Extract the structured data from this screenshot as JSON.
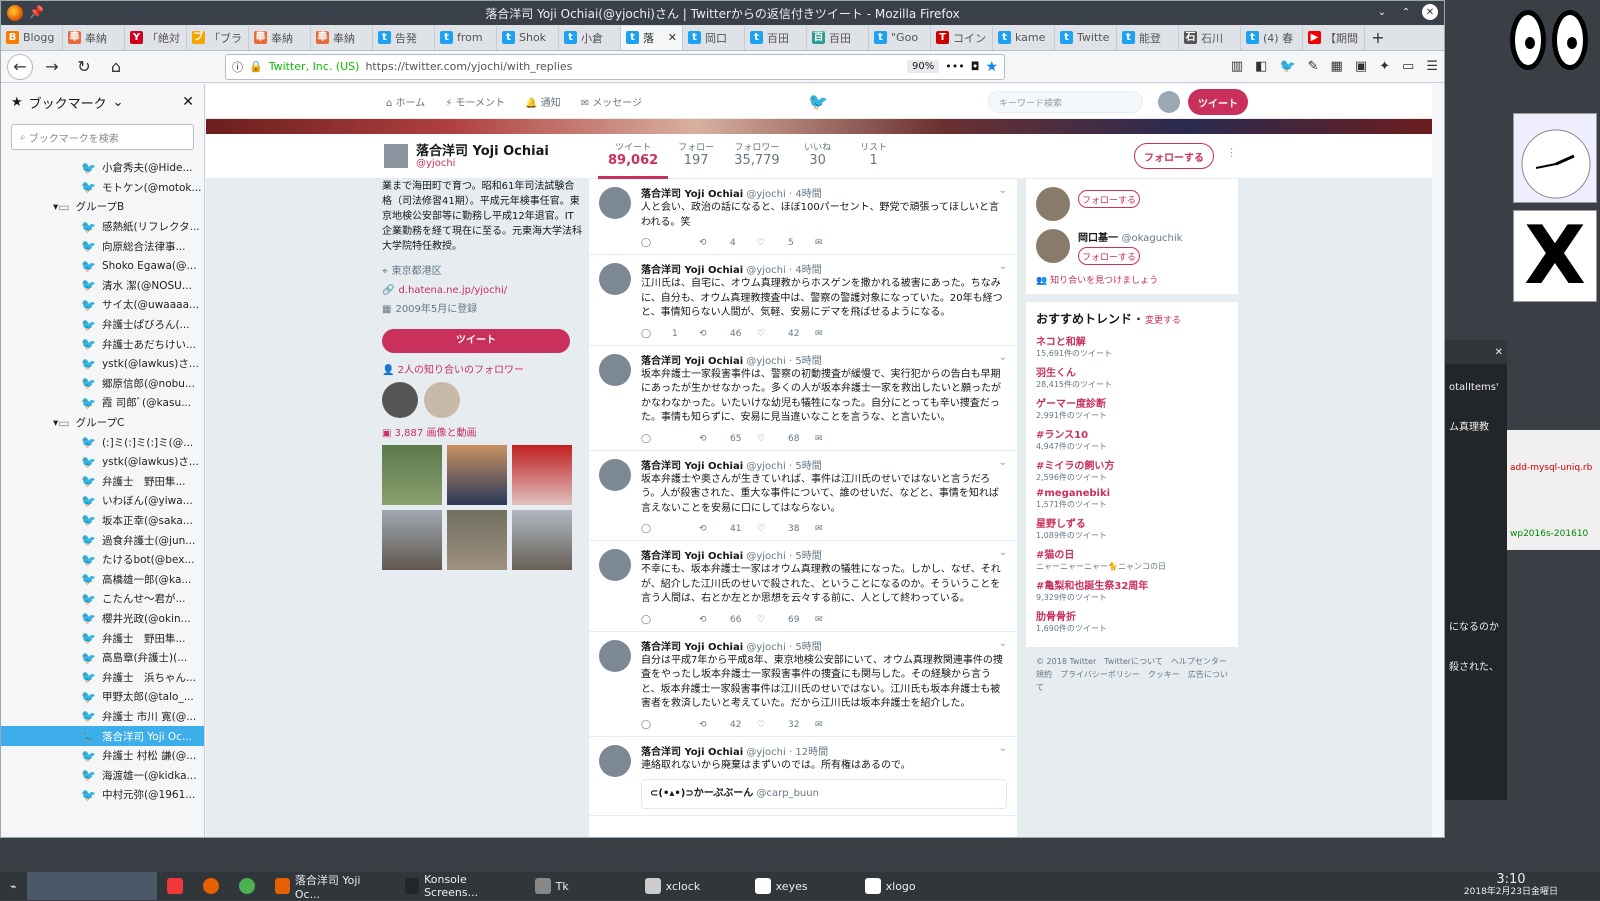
{
  "window": {
    "title": "落合洋司 Yoji Ochiai(@yjochi)さん | Twitterからの返信付きツイート - Mozilla Firefox"
  },
  "tabs": [
    {
      "label": "Blogg",
      "color": "#f57d00",
      "glyph": "B"
    },
    {
      "label": "奉納",
      "color": "#e8693a",
      "glyph": "奉"
    },
    {
      "label": "「絶対",
      "color": "#d0021b",
      "glyph": "Y"
    },
    {
      "label": "「ブラ",
      "color": "#f7a600",
      "glyph": "ブ"
    },
    {
      "label": "奉納",
      "color": "#e8693a",
      "glyph": "奉"
    },
    {
      "label": "奉納",
      "color": "#e8693a",
      "glyph": "奉"
    },
    {
      "label": "告発",
      "color": "#1da1f2",
      "glyph": "t"
    },
    {
      "label": "from",
      "color": "#1da1f2",
      "glyph": "t"
    },
    {
      "label": "Shok",
      "color": "#1da1f2",
      "glyph": "t"
    },
    {
      "label": "小倉",
      "color": "#1da1f2",
      "glyph": "t"
    },
    {
      "label": "落",
      "color": "#1da1f2",
      "glyph": "t",
      "active": true
    },
    {
      "label": "岡口",
      "color": "#1da1f2",
      "glyph": "t"
    },
    {
      "label": "百田",
      "color": "#1da1f2",
      "glyph": "t"
    },
    {
      "label": "百田",
      "color": "#2a9d8f",
      "glyph": "百"
    },
    {
      "label": "\"Goo",
      "color": "#1da1f2",
      "glyph": "t"
    },
    {
      "label": "コイン",
      "color": "#c00",
      "glyph": "T"
    },
    {
      "label": "kame",
      "color": "#1da1f2",
      "glyph": "t"
    },
    {
      "label": "Twitte",
      "color": "#1da1f2",
      "glyph": "t"
    },
    {
      "label": "能登",
      "color": "#1da1f2",
      "glyph": "t"
    },
    {
      "label": "石川",
      "color": "#555",
      "glyph": "石"
    },
    {
      "label": "(4) 春",
      "color": "#1da1f2",
      "glyph": "t"
    },
    {
      "label": "【期間",
      "color": "#e00",
      "glyph": "▶"
    }
  ],
  "nav": {
    "identity": "Twitter, Inc. (US)",
    "url": "https://twitter.com/yjochi/with_replies",
    "zoom": "90%"
  },
  "sidebar": {
    "title": "ブックマーク",
    "search_placeholder": "ブックマークを検索",
    "items": [
      {
        "label": "小倉秀夫(@Hide...",
        "indent": 80
      },
      {
        "label": "モトケン(@motok...",
        "indent": 80
      },
      {
        "label": "グループB",
        "indent": 52,
        "folder": true
      },
      {
        "label": "感熱紙(リフレクタ...",
        "indent": 80
      },
      {
        "label": "向原総合法律事...",
        "indent": 80
      },
      {
        "label": "Shoko Egawa(@...",
        "indent": 80
      },
      {
        "label": "清水 潔(@NOSU...",
        "indent": 80
      },
      {
        "label": "サイ太(@uwaaaa...",
        "indent": 80
      },
      {
        "label": "弁護士ぱびろん(...",
        "indent": 80
      },
      {
        "label": "弁護士あだちけい...",
        "indent": 80
      },
      {
        "label": "ystk(@lawkus)さ...",
        "indent": 80
      },
      {
        "label": "郷原信郎(@nobu...",
        "indent": 80
      },
      {
        "label": "霞 司郎ﾞ(@kasu...",
        "indent": 80
      },
      {
        "label": "グループC",
        "indent": 52,
        "folder": true
      },
      {
        "label": "(:]ミ(:]ミ(:]ミ(@...",
        "indent": 80
      },
      {
        "label": "ystk(@lawkus)さ...",
        "indent": 80
      },
      {
        "label": "弁護士　野田隼...",
        "indent": 80
      },
      {
        "label": "いわぼん(@yiwa...",
        "indent": 80
      },
      {
        "label": "坂本正幸(@saka...",
        "indent": 80
      },
      {
        "label": "過食弁護士(@jun...",
        "indent": 80
      },
      {
        "label": "たけるbot(@bex...",
        "indent": 80
      },
      {
        "label": "高橋雄一郎(@ka...",
        "indent": 80
      },
      {
        "label": "こたんせ〜君が...",
        "indent": 80
      },
      {
        "label": "櫻井光政(@okin...",
        "indent": 80
      },
      {
        "label": "弁護士　野田隼...",
        "indent": 80
      },
      {
        "label": "高島章(弁護士)(...",
        "indent": 80
      },
      {
        "label": "弁護士　浜ちゃん...",
        "indent": 80
      },
      {
        "label": "甲野太郎(@talo_...",
        "indent": 80
      },
      {
        "label": "弁護士 市川 寛(@...",
        "indent": 80
      },
      {
        "label": "落合洋司 Yoji Oc...",
        "indent": 80,
        "selected": true
      },
      {
        "label": "弁護士 村松 謙(@...",
        "indent": 80
      },
      {
        "label": "海渡雄一(@kidka...",
        "indent": 80
      },
      {
        "label": "中村元弥(@1961...",
        "indent": 80
      }
    ]
  },
  "twnav": {
    "home": "ホーム",
    "moments": "モーメント",
    "notifications": "通知",
    "messages": "メッセージ",
    "search_placeholder": "キーワード検索",
    "tweet": "ツイート"
  },
  "profile": {
    "name": "落合洋司 Yoji Ochiai",
    "handle": "@yjochi",
    "bio": "業まで海田町で育つ。昭和61年司法試験合格（司法修習41期）。平成元年検事任官。東京地検公安部等に勤務し平成12年退官。IT企業勤務を経て現在に至る。元東海大学法科大学院特任教授。",
    "location": "東京都港区",
    "link": "d.hatena.ne.jp/yjochi/",
    "joined": "2009年5月に登録",
    "tweet_button": "ツイート",
    "known_followers": "2人の知り合いのフォロワー",
    "media": "3,887 画像と動画",
    "follow": "フォローする"
  },
  "stats": [
    {
      "label": "ツイート",
      "value": "89,062",
      "active": true
    },
    {
      "label": "フォロー",
      "value": "197"
    },
    {
      "label": "フォロワー",
      "value": "35,779"
    },
    {
      "label": "いいね",
      "value": "30"
    },
    {
      "label": "リスト",
      "value": "1"
    }
  ],
  "tweets": [
    {
      "name": "落合洋司 Yoji Ochiai",
      "handle": "@yjochi",
      "time": "4時間",
      "text": "人と会い、政治の話になると、ほぼ100パーセント、野党で頑張ってほしいと言われる。笑",
      "reply": "",
      "rt": "4",
      "like": "5"
    },
    {
      "name": "落合洋司 Yoji Ochiai",
      "handle": "@yjochi",
      "time": "4時間",
      "text": "江川氏は、自宅に、オウム真理教からホスゲンを撒かれる被害にあった。ちなみに、自分も、オウム真理教捜査中は、警察の警護対象になっていた。20年も経つと、事情知らない人間が、気軽、安易にデマを飛ばせるようになる。",
      "reply": "1",
      "rt": "46",
      "like": "42"
    },
    {
      "name": "落合洋司 Yoji Ochiai",
      "handle": "@yjochi",
      "time": "5時間",
      "text": "坂本弁護士一家殺害事件は、警察の初動捜査が緩慢で、実行犯からの告白も早期にあったが生かせなかった。多くの人が坂本弁護士一家を救出したいと願ったがかなわなかった。いたいけな幼児も犠牲になった。自分にとっても辛い捜査だった。事情も知らずに、安易に見当違いなことを言うな、と言いたい。",
      "reply": "",
      "rt": "65",
      "like": "68"
    },
    {
      "name": "落合洋司 Yoji Ochiai",
      "handle": "@yjochi",
      "time": "5時間",
      "text": "坂本弁護士や奥さんが生きていれば、事件は江川氏のせいではないと言うだろう。人が殺害された、重大な事件について、誰のせいだ、などと、事情を知れば言えないことを安易に口にしてはならない。",
      "reply": "",
      "rt": "41",
      "like": "38"
    },
    {
      "name": "落合洋司 Yoji Ochiai",
      "handle": "@yjochi",
      "time": "5時間",
      "text": "不幸にも、坂本弁護士一家はオウム真理教の犠牲になった。しかし、なぜ、それが、紹介した江川氏のせいで殺された、ということになるのか。そういうことを言う人間は、右とか左とか思想を云々する前に、人として終わっている。",
      "reply": "",
      "rt": "66",
      "like": "69"
    },
    {
      "name": "落合洋司 Yoji Ochiai",
      "handle": "@yjochi",
      "time": "5時間",
      "text": "自分は平成7年から平成8年、東京地検公安部にいて、オウム真理教関連事件の捜査をやったし坂本弁護士一家殺害事件の捜査にも関与した。その経験から言うと、坂本弁護士一家殺害事件は江川氏のせいではない。江川氏も坂本弁護士も被害者を救済したいと考えていた。だから江川氏は坂本弁護士を紹介した。",
      "reply": "",
      "rt": "42",
      "like": "32"
    },
    {
      "name": "落合洋司 Yoji Ochiai",
      "handle": "@yjochi",
      "time": "12時間",
      "text": "連絡取れないから廃棄はまずいのでは。所有権はあるので。",
      "reply": "",
      "rt": "",
      "like": "",
      "quote": "⊂(•▴•)⊃かーぷぶーん",
      "quote_handle": "@carp_buun"
    }
  ],
  "suggest": [
    {
      "name": "",
      "handle": "",
      "follow": "フォローする"
    },
    {
      "name": "岡口基一",
      "handle": "@okaguchik",
      "follow": "フォローする"
    }
  ],
  "find_friends": "知り合いを見つけましょう",
  "trends_title": "おすすめトレンド",
  "trends_change": "変更する",
  "trends": [
    {
      "name": "ネコと和解",
      "count": "15,691件のツイート"
    },
    {
      "name": "羽生くん",
      "count": "28,415件のツイート"
    },
    {
      "name": "ゲーマー度診断",
      "count": "2,991件のツイート"
    },
    {
      "name": "#ランス10",
      "count": "4,947件のツイート"
    },
    {
      "name": "#ミイラの飼い方",
      "count": "2,596件のツイート"
    },
    {
      "name": "#meganebiki",
      "count": "1,571件のツイート"
    },
    {
      "name": "星野しずる",
      "count": "1,089件のツイート"
    },
    {
      "name": "#猫の日",
      "count": "ニャーニャーニャー🐈ニャンコの日"
    },
    {
      "name": "#亀梨和也誕生祭32周年",
      "count": "9,329件のツイート"
    },
    {
      "name": "肋骨骨折",
      "count": "1,690件のツイート"
    }
  ],
  "footer": "© 2018 Twitter　Twitterについて　ヘルプセンター　規約　プライバシーポリシー　クッキー　広告について",
  "taskbar": {
    "items": [
      {
        "label": "落合洋司 Yoji Oc...",
        "color": "#e66000"
      },
      {
        "label": "Konsole Screens...",
        "color": "#232629"
      },
      {
        "label": "Tk",
        "color": "#888"
      },
      {
        "label": "xclock",
        "color": "#ccc"
      },
      {
        "label": "xeyes",
        "color": "#fff"
      },
      {
        "label": "xlogo",
        "color": "#fff"
      }
    ],
    "time": "3:10",
    "date": "2018年2月23日金曜日"
  },
  "konsole": {
    "line1": "otalItems'",
    "line2": "ム真理教",
    "line3": "になるのか",
    "line4": "殺された、"
  },
  "tk": {
    "line1": "add-mysql-uniq.rb",
    "line2": "wp2016s-201610"
  }
}
